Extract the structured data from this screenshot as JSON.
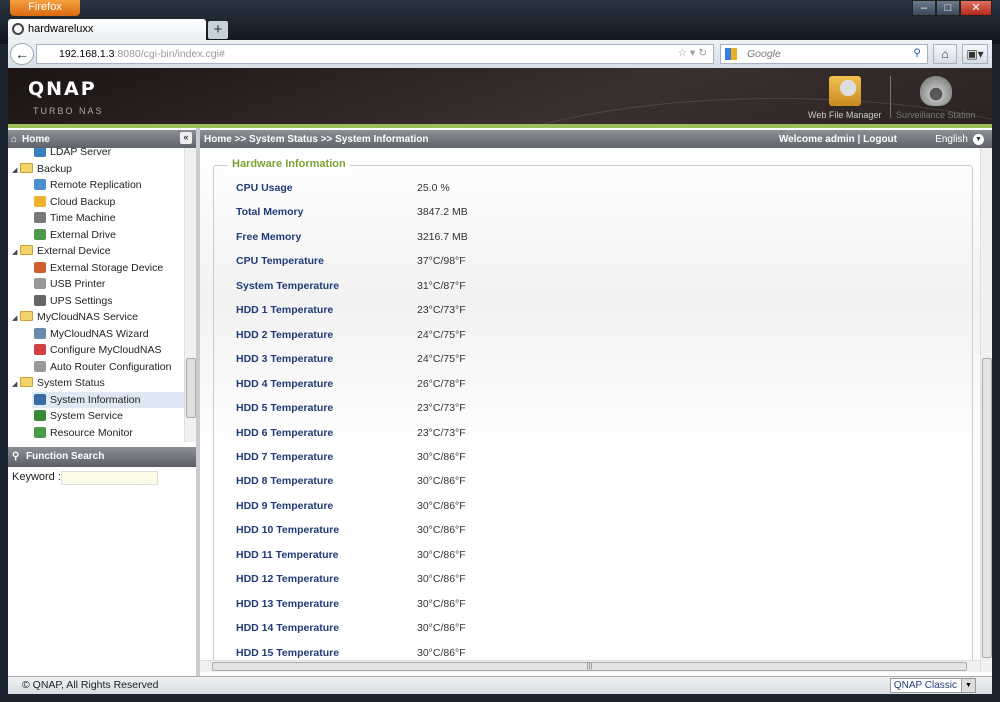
{
  "browser": {
    "menu_button": "Firefox",
    "tab_title": "hardwareluxx",
    "new_tab": "+",
    "url_host": "192.168.1.3",
    "url_rest": ":8080/cgi-bin/index.cgi#",
    "search_placeholder": "Google"
  },
  "header": {
    "logo": "QNAP",
    "subtitle": "TURBO NAS",
    "apps": [
      {
        "label": "Web File Manager",
        "icon": "folder-search-icon"
      },
      {
        "label": "Surveillance Station",
        "icon": "camera-dome-icon"
      }
    ]
  },
  "sidebar": {
    "title": "Home",
    "tree": [
      {
        "label": "LDAP Server",
        "type": "item",
        "color": "#3a7fc0"
      },
      {
        "label": "Backup",
        "type": "folder"
      },
      {
        "label": "Remote Replication",
        "type": "item",
        "color": "#4a8fd0"
      },
      {
        "label": "Cloud Backup",
        "type": "item",
        "color": "#f0b030"
      },
      {
        "label": "Time Machine",
        "type": "item",
        "color": "#777777"
      },
      {
        "label": "External Drive",
        "type": "item",
        "color": "#4a9a4a"
      },
      {
        "label": "External Device",
        "type": "folder"
      },
      {
        "label": "External Storage Device",
        "type": "item",
        "color": "#d06030"
      },
      {
        "label": "USB Printer",
        "type": "item",
        "color": "#999999"
      },
      {
        "label": "UPS Settings",
        "type": "item",
        "color": "#666666"
      },
      {
        "label": "MyCloudNAS Service",
        "type": "folder"
      },
      {
        "label": "MyCloudNAS Wizard",
        "type": "item",
        "color": "#6a8ab0"
      },
      {
        "label": "Configure MyCloudNAS",
        "type": "item",
        "color": "#d04040"
      },
      {
        "label": "Auto Router Configuration",
        "type": "item",
        "color": "#999999"
      },
      {
        "label": "System Status",
        "type": "folder"
      },
      {
        "label": "System Information",
        "type": "item",
        "color": "#3a6aa0",
        "selected": true
      },
      {
        "label": "System Service",
        "type": "item",
        "color": "#3a8a3a"
      },
      {
        "label": "Resource Monitor",
        "type": "item",
        "color": "#4a9a4a"
      }
    ],
    "function_search": "Function Search",
    "keyword_label": "Keyword :",
    "keyword_value": ""
  },
  "topbar": {
    "breadcrumb": "Home >> System Status >> System Information",
    "welcome": "Welcome admin | Logout",
    "language": "English"
  },
  "content": {
    "section": "Hardware Information",
    "rows": [
      {
        "k": "CPU Usage",
        "v": "25.0 %"
      },
      {
        "k": "Total Memory",
        "v": "3847.2 MB"
      },
      {
        "k": "Free Memory",
        "v": "3216.7 MB"
      },
      {
        "k": "CPU Temperature",
        "v": "37°C/98°F"
      },
      {
        "k": "System Temperature",
        "v": "31°C/87°F"
      },
      {
        "k": "HDD 1 Temperature",
        "v": "23°C/73°F"
      },
      {
        "k": "HDD 2 Temperature",
        "v": "24°C/75°F"
      },
      {
        "k": "HDD 3 Temperature",
        "v": "24°C/75°F"
      },
      {
        "k": "HDD 4 Temperature",
        "v": "26°C/78°F"
      },
      {
        "k": "HDD 5 Temperature",
        "v": "23°C/73°F"
      },
      {
        "k": "HDD 6 Temperature",
        "v": "23°C/73°F"
      },
      {
        "k": "HDD 7 Temperature",
        "v": "30°C/86°F"
      },
      {
        "k": "HDD 8 Temperature",
        "v": "30°C/86°F"
      },
      {
        "k": "HDD 9 Temperature",
        "v": "30°C/86°F"
      },
      {
        "k": "HDD 10 Temperature",
        "v": "30°C/86°F"
      },
      {
        "k": "HDD 11 Temperature",
        "v": "30°C/86°F"
      },
      {
        "k": "HDD 12 Temperature",
        "v": "30°C/86°F"
      },
      {
        "k": "HDD 13 Temperature",
        "v": "30°C/86°F"
      },
      {
        "k": "HDD 14 Temperature",
        "v": "30°C/86°F"
      },
      {
        "k": "HDD 15 Temperature",
        "v": "30°C/86°F"
      }
    ]
  },
  "footer": {
    "copyright": "© QNAP, All Rights Reserved",
    "theme": "QNAP Classic"
  },
  "colors": {
    "accent_green": "#9bbf58",
    "label_blue": "#1f3b78",
    "legend_green": "#7aa232"
  }
}
